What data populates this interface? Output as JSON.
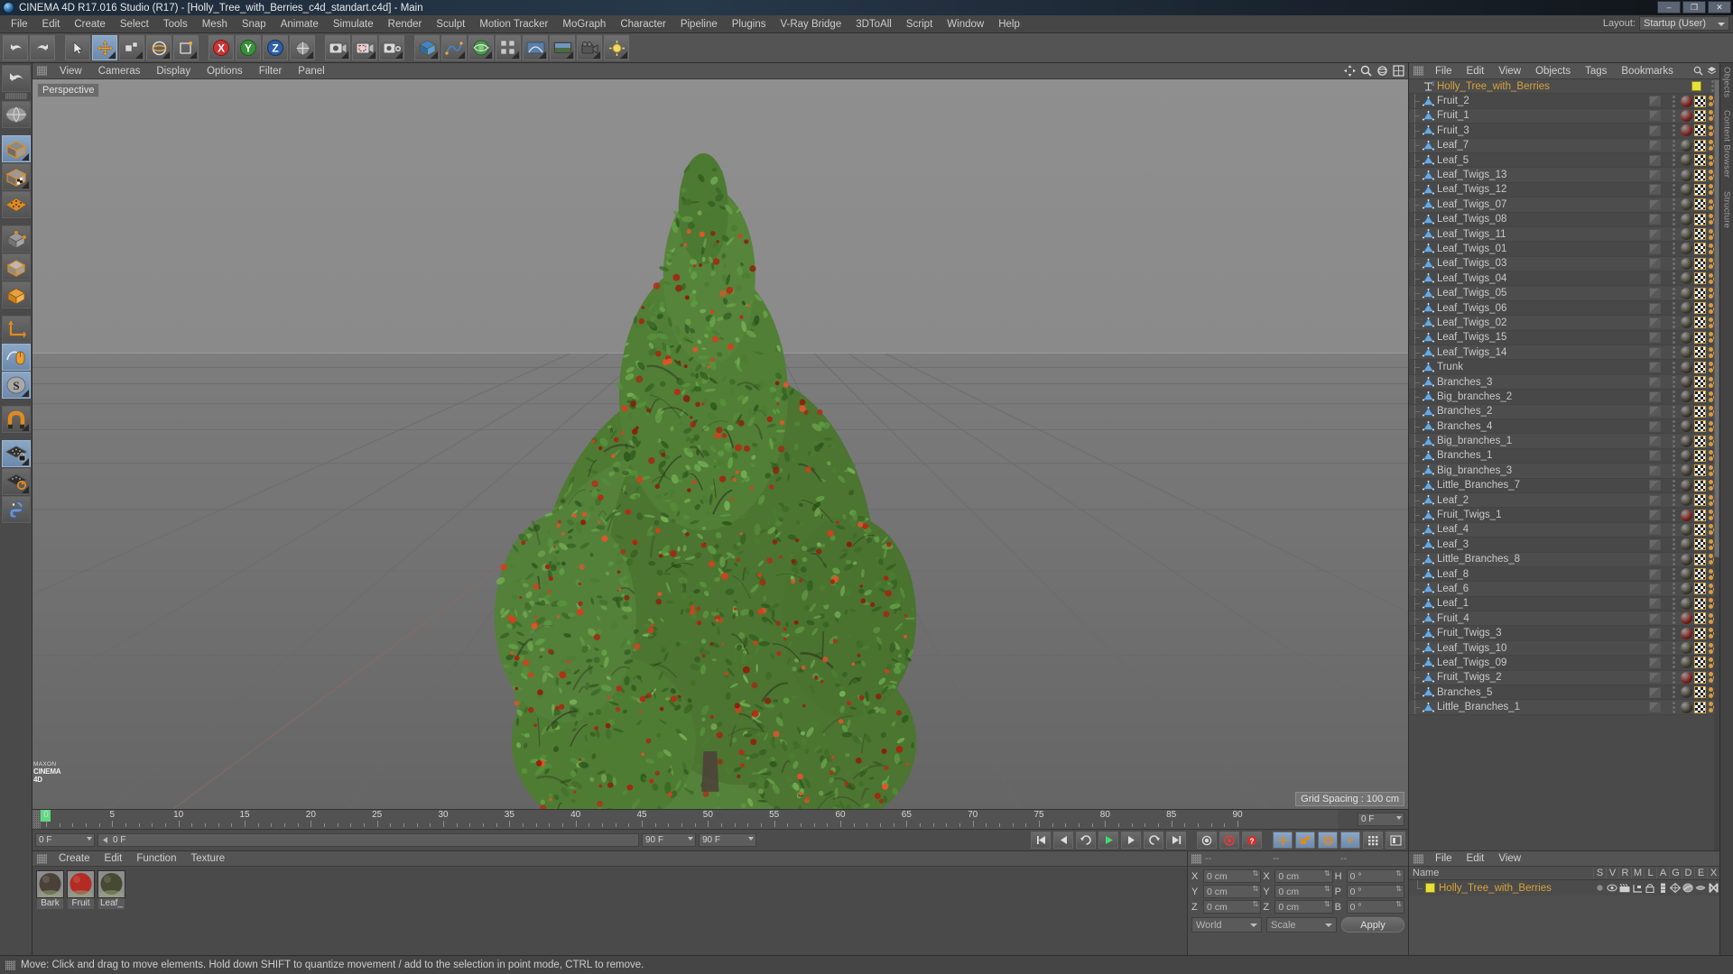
{
  "window": {
    "title": "CINEMA 4D R17.016 Studio (R17) - [Holly_Tree_with_Berries_c4d_standart.c4d] - Main",
    "app_icon": "c4d-logo-icon",
    "minimize": "–",
    "maximize": "❐",
    "close": "✕"
  },
  "menubar": {
    "items": [
      "File",
      "Edit",
      "Create",
      "Select",
      "Tools",
      "Mesh",
      "Snap",
      "Animate",
      "Simulate",
      "Render",
      "Sculpt",
      "Motion Tracker",
      "MoGraph",
      "Character",
      "Pipeline",
      "Plugins",
      "V-Ray Bridge",
      "3DToAll",
      "Script",
      "Window",
      "Help"
    ],
    "layout_label": "Layout:",
    "layout_value": "Startup (User)"
  },
  "toolbar": {
    "buttons": [
      {
        "name": "undo-button",
        "icon": "undo-arrow-icon",
        "active": false
      },
      {
        "name": "redo-button",
        "icon": "redo-arrow-icon",
        "active": false
      },
      {
        "name": "live-selection-button",
        "icon": "cursor-arrow-icon",
        "active": false
      },
      {
        "name": "move-tool-button",
        "icon": "move-axis-icon",
        "active": true
      },
      {
        "name": "scale-tool-button",
        "icon": "scale-box-icon",
        "active": false
      },
      {
        "name": "rotate-tool-button",
        "icon": "rotate-circle-icon",
        "active": false
      },
      {
        "name": "transform-tool-button",
        "icon": "transform-icon",
        "active": false
      },
      {
        "name": "lock-x-axis-button",
        "icon": "x-axis-icon",
        "active": false
      },
      {
        "name": "lock-y-axis-button",
        "icon": "y-axis-icon",
        "active": false
      },
      {
        "name": "lock-z-axis-button",
        "icon": "z-axis-icon",
        "active": false
      },
      {
        "name": "world-object-coord-button",
        "icon": "world-coordinates-icon",
        "active": false
      },
      {
        "name": "render-view-button",
        "icon": "render-view-icon",
        "active": false
      },
      {
        "name": "render-region-button",
        "icon": "render-region-icon",
        "active": false
      },
      {
        "name": "render-settings-button",
        "icon": "render-settings-icon",
        "active": false
      },
      {
        "name": "add-cube-button",
        "icon": "cube-primitive-icon",
        "active": false
      },
      {
        "name": "add-spline-button",
        "icon": "spline-pen-icon",
        "active": false
      },
      {
        "name": "add-nurbs-button",
        "icon": "nurbs-generator-icon",
        "active": false
      },
      {
        "name": "add-array-button",
        "icon": "array-modeling-icon",
        "active": false
      },
      {
        "name": "add-deformer-button",
        "icon": "bend-deformer-icon",
        "active": false
      },
      {
        "name": "add-floor-button",
        "icon": "environment-floor-icon",
        "active": false
      },
      {
        "name": "add-camera-button",
        "icon": "camera-icon",
        "active": false
      },
      {
        "name": "add-light-button",
        "icon": "light-bulb-icon",
        "active": false
      }
    ]
  },
  "left_toolbar": {
    "buttons": [
      {
        "name": "tool-undo-view",
        "icon": "undo-view-icon",
        "active": false
      },
      {
        "name": "tool-make-editable",
        "icon": "globe-editable-icon",
        "active": false
      },
      {
        "name": "tool-model-mode",
        "icon": "model-cube-icon",
        "active": true
      },
      {
        "name": "tool-texture-mode",
        "icon": "texture-cube-icon",
        "active": false
      },
      {
        "name": "tool-points-mode",
        "icon": "points-mesh-icon",
        "active": false
      },
      {
        "name": "tool-edges-mode",
        "icon": "edges-cube-icon",
        "active": false
      },
      {
        "name": "tool-polygons-mode",
        "icon": "polygon-cube-icon",
        "active": false
      },
      {
        "name": "tool-axis-mode",
        "icon": "axis-cube-icon",
        "active": false
      },
      {
        "name": "tool-world-axis",
        "icon": "world-axis-icon",
        "active": false
      },
      {
        "name": "tool-viewport-solo",
        "icon": "mouse-viewport-icon",
        "active": true
      },
      {
        "name": "tool-snap-enable",
        "icon": "snap-s-icon",
        "active": true
      },
      {
        "name": "tool-magnet",
        "icon": "magnet-icon",
        "active": false
      },
      {
        "name": "tool-workplane-lock",
        "icon": "workplane-lock-icon",
        "active": true
      },
      {
        "name": "tool-workplane-rotate",
        "icon": "workplane-rotate-icon",
        "active": false
      },
      {
        "name": "tool-python",
        "icon": "python-script-icon",
        "active": false
      }
    ]
  },
  "viewport": {
    "menu": [
      "View",
      "Cameras",
      "Display",
      "Options",
      "Filter",
      "Panel"
    ],
    "label": "Perspective",
    "grid_spacing": "Grid Spacing : 100 cm",
    "header_icons": [
      "pan-view-icon",
      "zoom-view-icon",
      "rotate-view-icon",
      "maximize-view-icon"
    ]
  },
  "timeline": {
    "ticks": [
      "0",
      "5",
      "10",
      "15",
      "20",
      "25",
      "30",
      "35",
      "40",
      "45",
      "50",
      "55",
      "60",
      "65",
      "70",
      "75",
      "80",
      "85",
      "90"
    ],
    "current_frame_right": "0 F",
    "frame_field": "0 F",
    "frame_field2": "0 F",
    "range_start": "90 F",
    "range_end": "90 F"
  },
  "transport": {
    "buttons": [
      {
        "name": "go-to-start-button",
        "icon": "skip-start-icon"
      },
      {
        "name": "previous-frame-button",
        "icon": "step-back-icon"
      },
      {
        "name": "previous-key-button",
        "icon": "prev-key-icon"
      },
      {
        "name": "play-button",
        "icon": "play-icon"
      },
      {
        "name": "next-frame-button",
        "icon": "step-forward-icon"
      },
      {
        "name": "loop-button",
        "icon": "loop-icon"
      },
      {
        "name": "go-to-end-button",
        "icon": "skip-end-icon"
      },
      {
        "name": "record-active-button",
        "icon": "record-key-icon"
      },
      {
        "name": "autokey-button",
        "icon": "autokey-icon"
      },
      {
        "name": "keyframe-help-button",
        "icon": "question-icon"
      },
      {
        "name": "position-key-button",
        "icon": "position-key-icon"
      },
      {
        "name": "scale-key-button",
        "icon": "scale-key-icon"
      },
      {
        "name": "rotation-key-button",
        "icon": "rotation-key-icon"
      },
      {
        "name": "param-key-button",
        "icon": "param-key-icon"
      },
      {
        "name": "point-level-anim-button",
        "icon": "pla-icon"
      },
      {
        "name": "layout-key-button",
        "icon": "key-layout-icon"
      }
    ]
  },
  "material_manager": {
    "menu": [
      "Create",
      "Edit",
      "Function",
      "Texture"
    ],
    "materials": [
      {
        "name": "Bark",
        "color": "#4a4236"
      },
      {
        "name": "Fruit",
        "color": "#b32b22"
      },
      {
        "name": "Leaf_",
        "color": "#474a32"
      }
    ]
  },
  "coordinates": {
    "headers": [
      "--",
      "--",
      "--"
    ],
    "rows": [
      {
        "label1": "X",
        "value1": "0 cm",
        "label2": "X",
        "value2": "0 cm",
        "label3": "H",
        "value3": "0 °"
      },
      {
        "label1": "Y",
        "value1": "0 cm",
        "label2": "Y",
        "value2": "0 cm",
        "label3": "P",
        "value3": "0 °"
      },
      {
        "label1": "Z",
        "value1": "0 cm",
        "label2": "Z",
        "value2": "0 cm",
        "label3": "B",
        "value3": "0 °"
      }
    ],
    "coord_system": "World",
    "mode": "Scale",
    "apply_label": "Apply"
  },
  "object_manager": {
    "menu": [
      "File",
      "Edit",
      "View",
      "Objects",
      "Tags",
      "Bookmarks"
    ],
    "root": {
      "name": "Holly_Tree_with_Berries",
      "color": "#e8e03a"
    },
    "objects": [
      {
        "name": "Fruit_2",
        "mat": "#7a1b16"
      },
      {
        "name": "Fruit_1",
        "mat": "#7a1b16"
      },
      {
        "name": "Fruit_3",
        "mat": "#7a1b16"
      },
      {
        "name": "Leaf_7",
        "mat": "#3b3a2a"
      },
      {
        "name": "Leaf_5",
        "mat": "#3b3a2a"
      },
      {
        "name": "Leaf_Twigs_13",
        "mat": "#3b3a2a"
      },
      {
        "name": "Leaf_Twigs_12",
        "mat": "#3b3a2a"
      },
      {
        "name": "Leaf_Twigs_07",
        "mat": "#3b3a2a"
      },
      {
        "name": "Leaf_Twigs_08",
        "mat": "#3b3a2a"
      },
      {
        "name": "Leaf_Twigs_11",
        "mat": "#3b3a2a"
      },
      {
        "name": "Leaf_Twigs_01",
        "mat": "#3b3a2a"
      },
      {
        "name": "Leaf_Twigs_03",
        "mat": "#3b3a2a"
      },
      {
        "name": "Leaf_Twigs_04",
        "mat": "#3b3a2a"
      },
      {
        "name": "Leaf_Twigs_05",
        "mat": "#3b3a2a"
      },
      {
        "name": "Leaf_Twigs_06",
        "mat": "#3b3a2a"
      },
      {
        "name": "Leaf_Twigs_02",
        "mat": "#3b3a2a"
      },
      {
        "name": "Leaf_Twigs_15",
        "mat": "#3b3a2a"
      },
      {
        "name": "Leaf_Twigs_14",
        "mat": "#3b3a2a"
      },
      {
        "name": "Trunk",
        "mat": "#3b352a"
      },
      {
        "name": "Branches_3",
        "mat": "#3b352a"
      },
      {
        "name": "Big_branches_2",
        "mat": "#3b352a"
      },
      {
        "name": "Branches_2",
        "mat": "#3b352a"
      },
      {
        "name": "Branches_4",
        "mat": "#3b352a"
      },
      {
        "name": "Big_branches_1",
        "mat": "#3b352a"
      },
      {
        "name": "Branches_1",
        "mat": "#3b352a"
      },
      {
        "name": "Big_branches_3",
        "mat": "#3b352a"
      },
      {
        "name": "Little_Branches_7",
        "mat": "#3b352a"
      },
      {
        "name": "Leaf_2",
        "mat": "#3b3a2a"
      },
      {
        "name": "Fruit_Twigs_1",
        "mat": "#7a1b16"
      },
      {
        "name": "Leaf_4",
        "mat": "#3b3a2a"
      },
      {
        "name": "Leaf_3",
        "mat": "#3b3a2a"
      },
      {
        "name": "Little_Branches_8",
        "mat": "#3b352a"
      },
      {
        "name": "Leaf_8",
        "mat": "#3b3a2a"
      },
      {
        "name": "Leaf_6",
        "mat": "#3b3a2a"
      },
      {
        "name": "Leaf_1",
        "mat": "#3b3a2a"
      },
      {
        "name": "Fruit_4",
        "mat": "#7a1b16"
      },
      {
        "name": "Fruit_Twigs_3",
        "mat": "#7a1b16"
      },
      {
        "name": "Leaf_Twigs_10",
        "mat": "#3b3a2a"
      },
      {
        "name": "Leaf_Twigs_09",
        "mat": "#3b3a2a"
      },
      {
        "name": "Fruit_Twigs_2",
        "mat": "#7a1b16"
      },
      {
        "name": "Branches_5",
        "mat": "#3b352a"
      },
      {
        "name": "Little_Branches_1",
        "mat": "#3b352a"
      }
    ]
  },
  "attribute_manager": {
    "menu": [
      "File",
      "Edit",
      "View"
    ],
    "name_header": "Name",
    "columns": [
      "S",
      "V",
      "R",
      "M",
      "L",
      "A",
      "G",
      "D",
      "E",
      "X"
    ],
    "row": {
      "name": "Holly_Tree_with_Berries",
      "color": "#e8e03a"
    }
  },
  "right_tabs": [
    "Objects",
    "Content Browser",
    "Structure"
  ],
  "status": {
    "message": "Move: Click and drag to move elements. Hold down SHIFT to quantize movement / add to the selection in point mode, CTRL to remove."
  },
  "branding": {
    "line1": "MAXON",
    "line2": "CINEMA 4D"
  },
  "colors": {
    "accent_orange": "#d8a23a",
    "selection_blue": "#7c9ac0",
    "yellow_tag": "#e8e03a",
    "play_green": "#44d96a",
    "record_red": "#e23b3b"
  }
}
